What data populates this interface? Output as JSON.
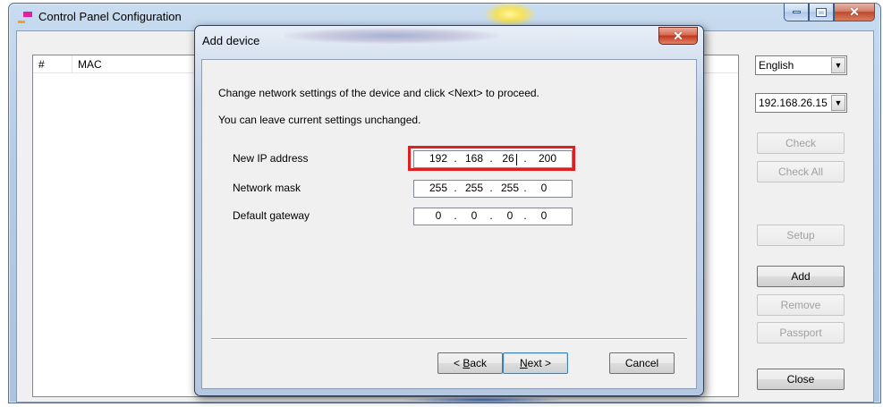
{
  "main_window": {
    "title": "Control Panel Configuration",
    "list_columns": [
      "#",
      "MAC"
    ]
  },
  "right_panel": {
    "language": "English",
    "ip_select": "192.168.26.15",
    "buttons": {
      "check": "Check",
      "check_all": "Check All",
      "setup": "Setup",
      "add": "Add",
      "remove": "Remove",
      "passport": "Passport",
      "close": "Close"
    }
  },
  "dialog": {
    "title": "Add device",
    "line1": "Change network settings of the device and click <Next> to proceed.",
    "line2": "You can leave current settings unchanged.",
    "fields": [
      {
        "label": "New IP address",
        "octets": [
          "192",
          "168",
          "26",
          "200"
        ]
      },
      {
        "label": "Network mask",
        "octets": [
          "255",
          "255",
          "255",
          "0"
        ]
      },
      {
        "label": "Default gateway",
        "octets": [
          "0",
          "0",
          "0",
          "0"
        ]
      }
    ],
    "buttons": {
      "back_prefix": "< ",
      "back_mnemonic": "B",
      "back_rest": "ack",
      "next_mnemonic": "N",
      "next_rest": "ext >",
      "cancel": "Cancel"
    }
  },
  "ip_separator": ".",
  "colors": {
    "highlight": "#e02020",
    "window_frame": "#b3cbe6",
    "dialog_client": "#f0f0f0"
  },
  "icons": [
    "app-icon",
    "minimize-icon",
    "maximize-icon",
    "close-icon",
    "dropdown-arrow-icon"
  ]
}
